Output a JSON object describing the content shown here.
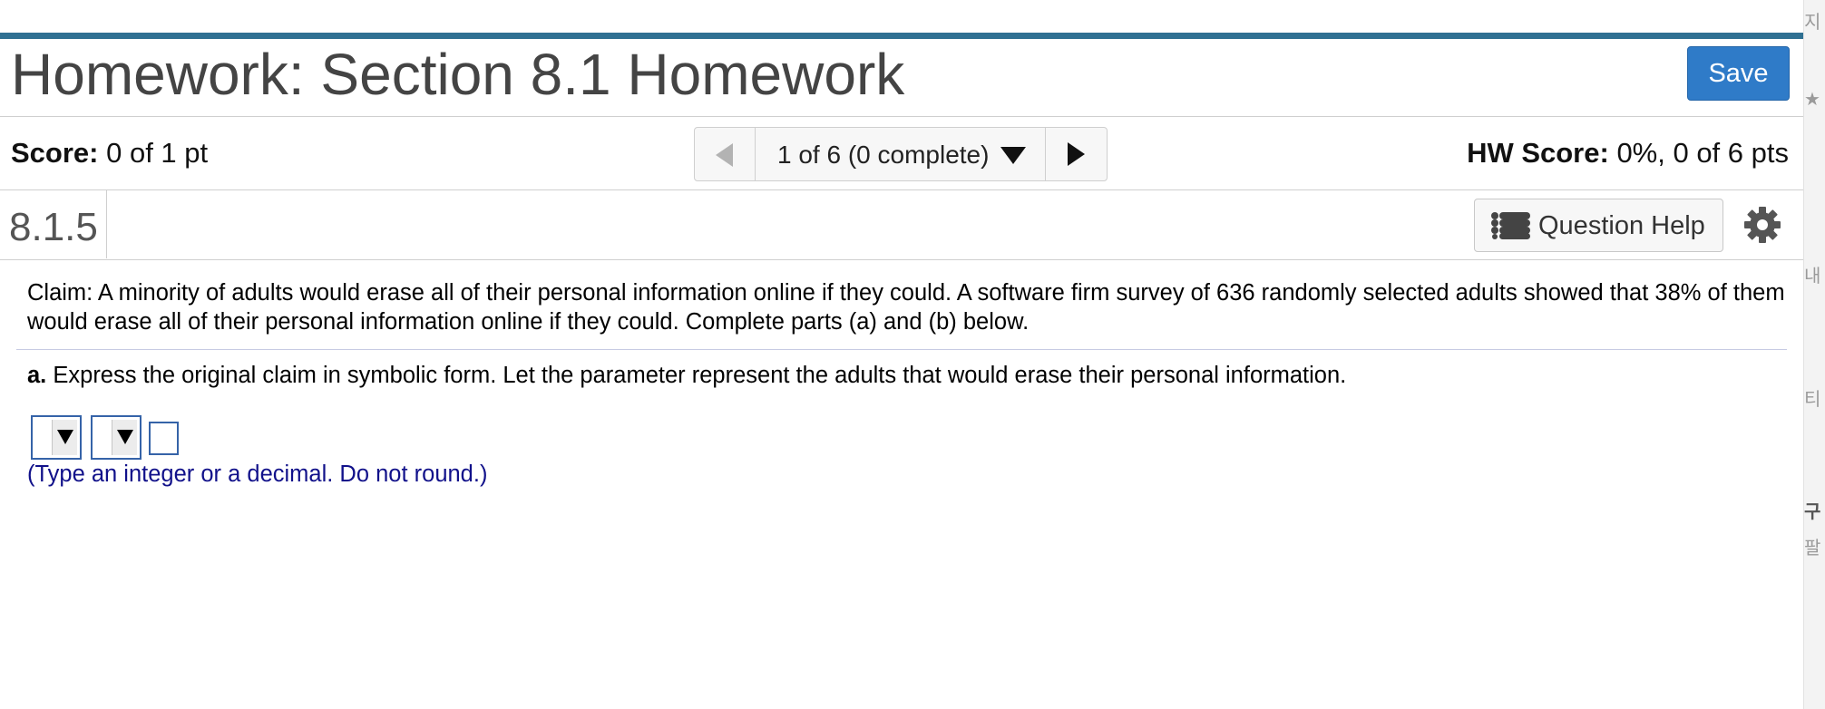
{
  "header": {
    "title": "Homework: Section 8.1 Homework",
    "save_label": "Save"
  },
  "score_bar": {
    "score_label": "Score:",
    "score_value": "0 of 1 pt",
    "question_nav": "1 of 6 (0 complete)",
    "hw_score_label": "HW Score:",
    "hw_score_value": "0%, 0 of 6 pts"
  },
  "question": {
    "id": "8.1.5",
    "help_label": "Question Help",
    "claim": "Claim: A minority of adults would erase all of their personal information online if they could. A software firm survey of 636 randomly selected adults showed that 38% of them would erase all of their personal information online if they could. Complete parts (a) and (b) below.",
    "part_a_label": "a.",
    "part_a_text": "Express the original claim in symbolic form. Let the parameter represent the adults that would erase their personal information.",
    "answer_value": "",
    "hint": "(Type an integer or a decimal. Do not round.)"
  },
  "icons": {
    "prev": "triangle-left-icon",
    "dropdown": "caret-down-icon",
    "next": "triangle-right-icon",
    "help": "list-icon",
    "settings": "gear-icon"
  },
  "colors": {
    "top_bar": "#2f7092",
    "save_button": "#2f7bc8",
    "hint_text": "#11118a",
    "input_border": "#3563a8"
  }
}
